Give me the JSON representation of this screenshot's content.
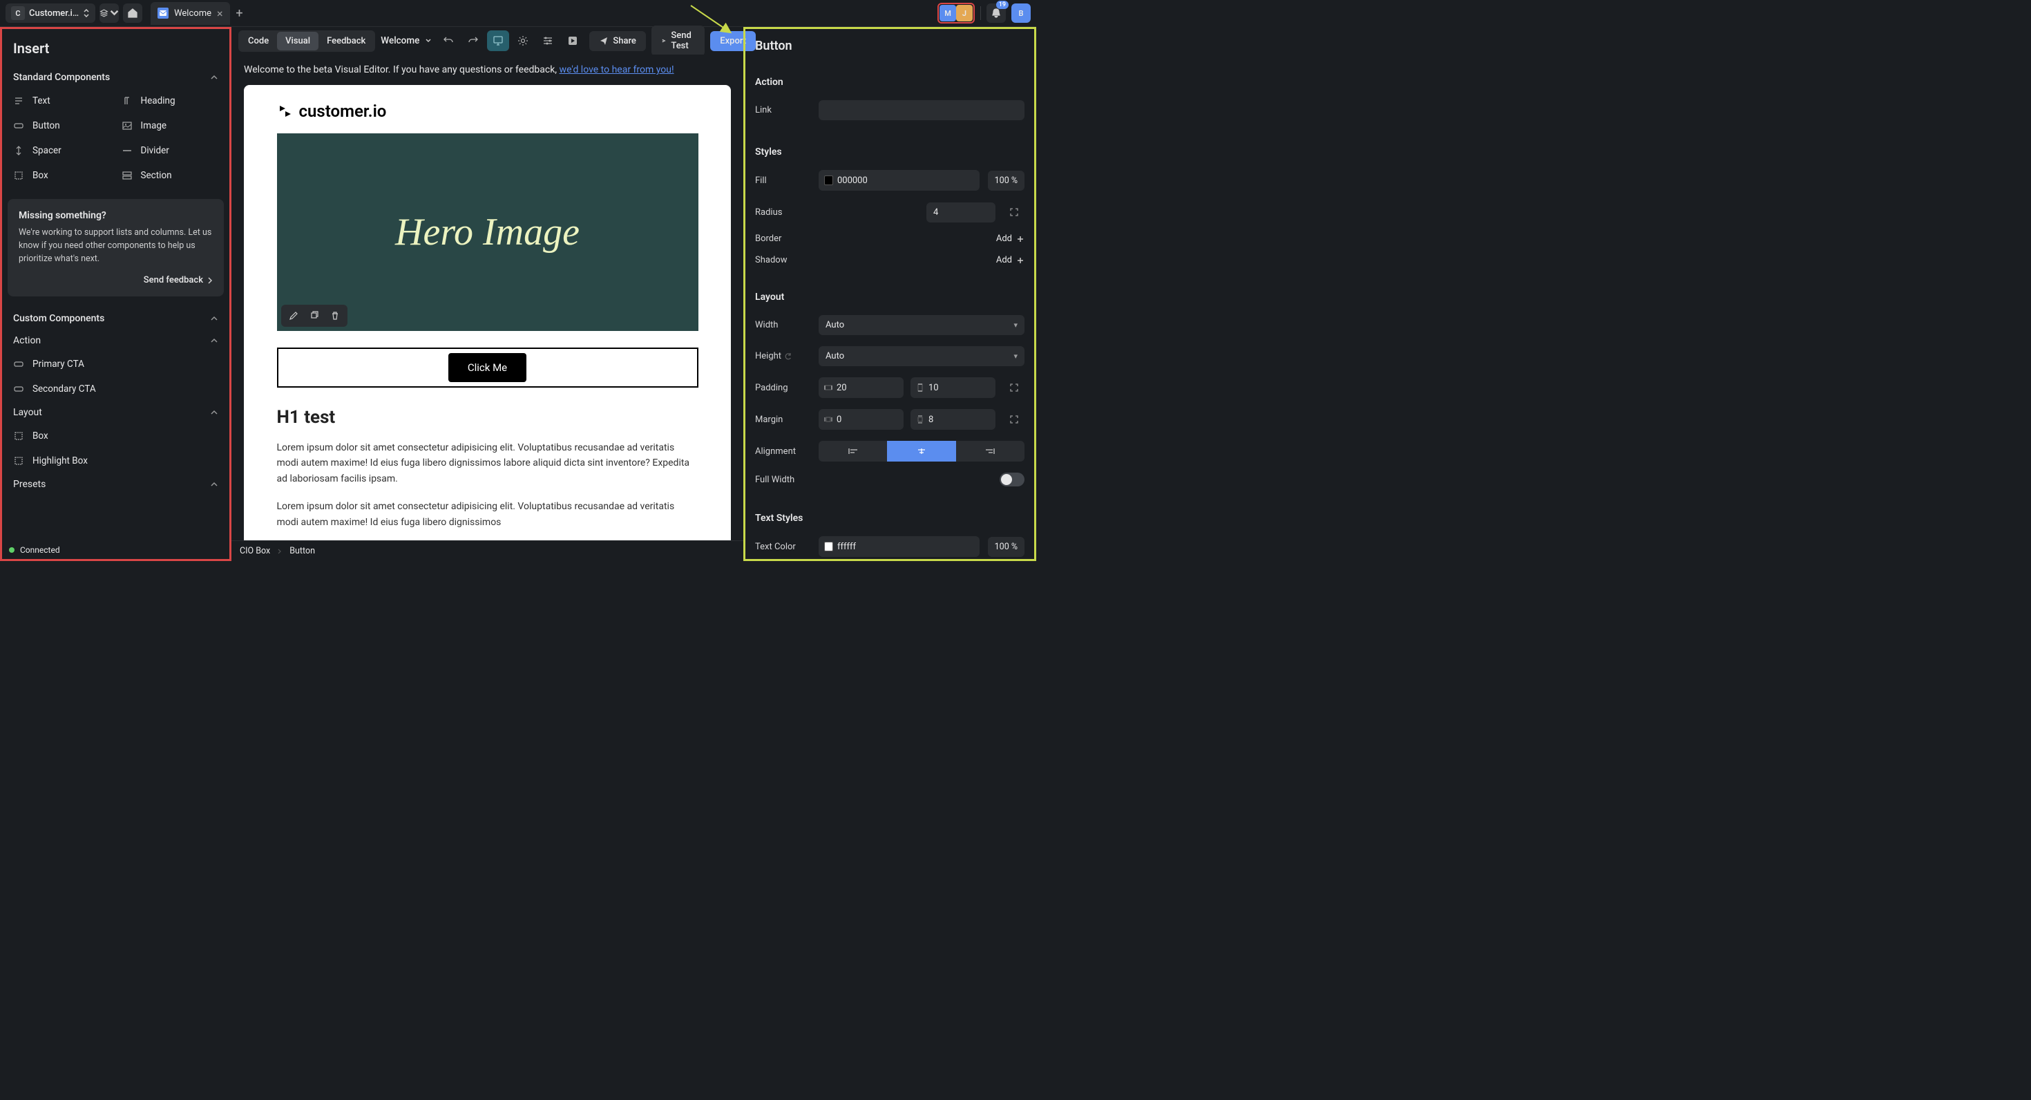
{
  "topbar": {
    "workspace_initial": "C",
    "workspace_name": "Customer.i…",
    "tab_label": "Welcome",
    "avatars": [
      {
        "letter": "M",
        "bg": "#5b8def"
      },
      {
        "letter": "J",
        "bg": "#e4a853"
      }
    ],
    "notification_count": "19",
    "user_avatar": {
      "letter": "B",
      "bg": "#5b8def"
    }
  },
  "insert": {
    "title": "Insert",
    "sections": {
      "standard": {
        "title": "Standard Components",
        "items": [
          {
            "label": "Text"
          },
          {
            "label": "Heading"
          },
          {
            "label": "Button"
          },
          {
            "label": "Image"
          },
          {
            "label": "Spacer"
          },
          {
            "label": "Divider"
          },
          {
            "label": "Box"
          },
          {
            "label": "Section"
          }
        ]
      },
      "info_card": {
        "title": "Missing something?",
        "body": "We're working to support lists and columns. Let us know if you need other components to help us prioritize what's next.",
        "cta": "Send feedback"
      },
      "custom": {
        "title": "Custom Components"
      },
      "action": {
        "title": "Action",
        "items": [
          {
            "label": "Primary CTA"
          },
          {
            "label": "Secondary CTA"
          }
        ]
      },
      "layout": {
        "title": "Layout",
        "items": [
          {
            "label": "Box"
          },
          {
            "label": "Highlight Box"
          }
        ]
      },
      "presets": {
        "title": "Presets"
      }
    },
    "status": "Connected"
  },
  "toolbar": {
    "modes": {
      "code": "Code",
      "visual": "Visual",
      "feedback": "Feedback"
    },
    "doc_title": "Welcome",
    "share": "Share",
    "send_test": "Send Test",
    "export": "Export"
  },
  "banner": {
    "text_pre": "Welcome to the beta Visual Editor. If you have any questions or feedback, ",
    "link": "we'd love to hear from you!"
  },
  "canvas": {
    "logo_text": "customer.io",
    "hero_text": "Hero Image",
    "cta_label": "Click Me",
    "h1": "H1 test",
    "p1": "Lorem ipsum dolor sit amet consectetur adipisicing elit. Voluptatibus recusandae ad veritatis modi autem maxime! Id eius fuga libero dignissimos labore aliquid dicta sint inventore? Expedita ad laboriosam facilis ipsam.",
    "p2": "Lorem ipsum dolor sit amet consectetur adipisicing elit. Voluptatibus recusandae ad veritatis modi autem maxime! Id eius fuga libero dignissimos"
  },
  "breadcrumb": {
    "a": "CIO Box",
    "b": "Button"
  },
  "props": {
    "title": "Button",
    "action": {
      "title": "Action",
      "link_label": "Link",
      "link_value": ""
    },
    "styles": {
      "title": "Styles",
      "fill_label": "Fill",
      "fill_value": "000000",
      "fill_pct": "100 %",
      "radius_label": "Radius",
      "radius_value": "4",
      "border_label": "Border",
      "border_btn": "Add",
      "shadow_label": "Shadow",
      "shadow_btn": "Add"
    },
    "layout": {
      "title": "Layout",
      "width_label": "Width",
      "width_value": "Auto",
      "height_label": "Height",
      "height_value": "Auto",
      "padding_label": "Padding",
      "padding_h": "20",
      "padding_v": "10",
      "margin_label": "Margin",
      "margin_h": "0",
      "margin_v": "8",
      "align_label": "Alignment",
      "fullwidth_label": "Full Width"
    },
    "text_styles": {
      "title": "Text Styles",
      "color_label": "Text Color",
      "color_value": "ffffff",
      "color_pct": "100 %"
    }
  }
}
